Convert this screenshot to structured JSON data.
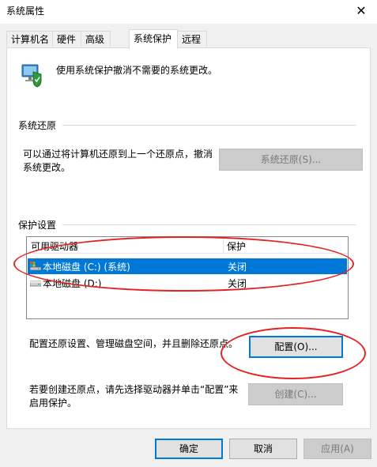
{
  "window": {
    "title": "系统属性",
    "close_glyph": "✕"
  },
  "tabs": [
    {
      "label": "计算机名",
      "active": false
    },
    {
      "label": "硬件",
      "active": false
    },
    {
      "label": "高级",
      "active": false
    },
    {
      "label": "系统保护",
      "active": true
    },
    {
      "label": "远程",
      "active": false
    }
  ],
  "header": {
    "text": "使用系统保护撤消不需要的系统更改。",
    "icon": "system-protection-icon"
  },
  "restore": {
    "section": "系统还原",
    "description_line1": "可以通过将计算机还原到上一个还原点，撤消",
    "description_line2": "系统更改。",
    "button": "系统还原(S)...",
    "button_enabled": false
  },
  "protection": {
    "section": "保护设置",
    "columns": [
      "可用驱动器",
      "保护"
    ],
    "drives": [
      {
        "name": "本地磁盘 (C:) (系统)",
        "status": "关闭",
        "selected": true,
        "icon": "system-drive-icon"
      },
      {
        "name": "本地磁盘 (D:)",
        "status": "关闭",
        "selected": false,
        "icon": "drive-icon"
      }
    ],
    "configure_text": "配置还原设置、管理磁盘空间，并且删除还原点。",
    "configure_button": "配置(O)...",
    "create_line1": "若要创建还原点，请先选择驱动器并单击“配置”来",
    "create_line2": "启用保护。",
    "create_button": "创建(C)...",
    "create_enabled": false
  },
  "footer": {
    "ok": "确定",
    "cancel": "取消",
    "apply": "应用(A)",
    "apply_enabled": false
  },
  "colors": {
    "selection": "#0078d7",
    "annotation": "#e52222",
    "window_bg": "#f0f0f0"
  }
}
